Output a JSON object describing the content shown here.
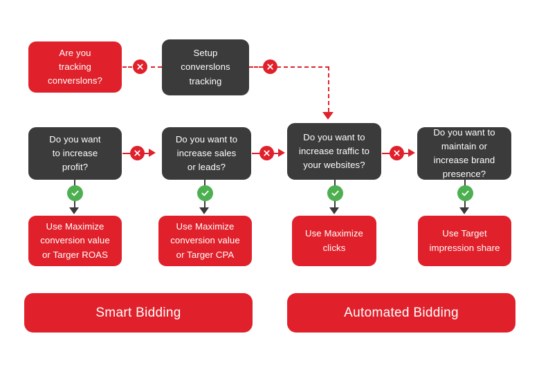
{
  "diagram": {
    "title": "Google Ads Bidding Strategy Decision Flowchart",
    "colors": {
      "red": "#E0212B",
      "dark": "#3B3B3B",
      "green": "#4CAF50",
      "background": "#FFFFFF",
      "text": "#FFFFFF"
    }
  },
  "nodes": {
    "row1": [
      {
        "id": "tracking-question",
        "style": "red",
        "lines": [
          "Are you",
          "tracking",
          "converslons?"
        ]
      },
      {
        "id": "setup-tracking",
        "style": "dark",
        "lines": [
          "Setup",
          "converslons",
          "tracking"
        ]
      }
    ],
    "row2": [
      {
        "id": "increase-profit",
        "style": "dark",
        "lines": [
          "Do you want",
          "to increase",
          "profit?"
        ]
      },
      {
        "id": "increase-sales",
        "style": "dark",
        "lines": [
          "Do you want to",
          "increase sales",
          "or leads?"
        ]
      },
      {
        "id": "increase-traffic",
        "style": "dark",
        "lines": [
          "Do you want to",
          "increase traffic to",
          "your websites?"
        ]
      },
      {
        "id": "brand-presence",
        "style": "dark",
        "lines": [
          "Do you want to",
          "maintain or",
          "increase brand",
          "presence?"
        ]
      }
    ],
    "row3": [
      {
        "id": "maximize-conversion-value-roas",
        "style": "red",
        "lines": [
          "Use Maximize",
          "conversion value",
          "or Targer ROAS"
        ]
      },
      {
        "id": "maximize-conversion-value-cpa",
        "style": "red",
        "lines": [
          "Use Maximize",
          "conversion value",
          "or Targer CPA"
        ]
      },
      {
        "id": "maximize-clicks",
        "style": "red",
        "lines": [
          "Use Maximize",
          "clicks"
        ]
      },
      {
        "id": "target-impression-share",
        "style": "red",
        "lines": [
          "Use Target",
          "impression share"
        ]
      }
    ]
  },
  "banners": [
    {
      "id": "smart-bidding",
      "label": "Smart Bidding"
    },
    {
      "id": "automated-bidding",
      "label": "Automated Bidding"
    }
  ],
  "badges": {
    "x_icon_name": "x-mark-icon",
    "check_icon_name": "check-mark-icon",
    "x_count": 5,
    "check_count": 4
  }
}
